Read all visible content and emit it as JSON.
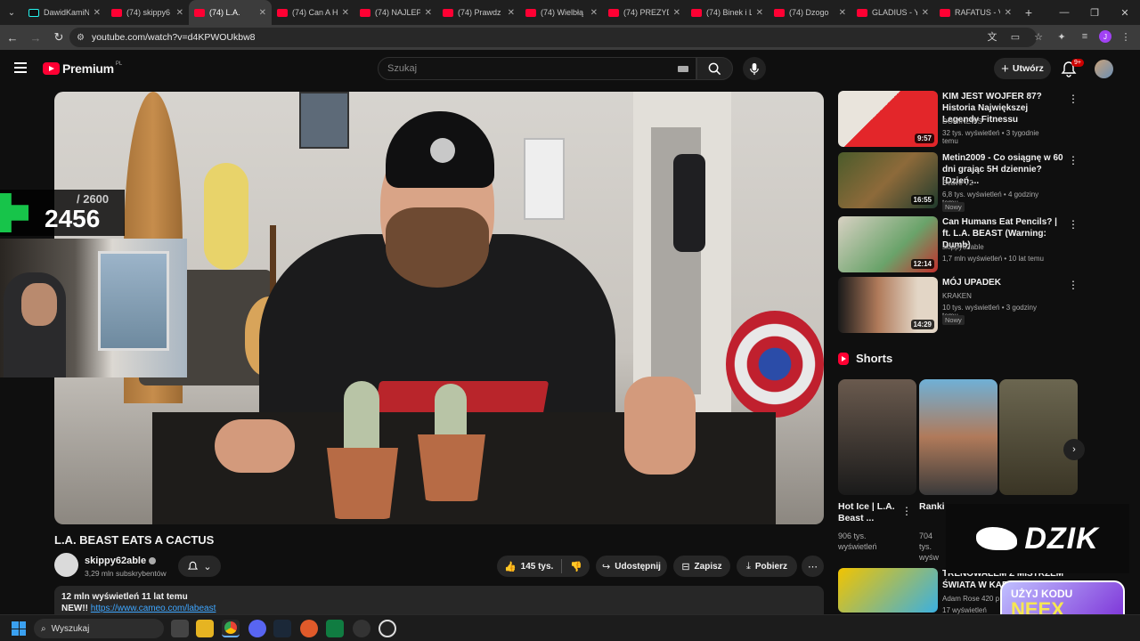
{
  "browser": {
    "tabs": [
      {
        "title": "DawidKamiN",
        "icon": "tiktok-icon",
        "active": false
      },
      {
        "title": "(74) skippy6",
        "icon": "youtube-icon",
        "active": false
      },
      {
        "title": "(74) L.A.",
        "icon": "youtube-icon",
        "active": true
      },
      {
        "title": "(74) Can A H",
        "icon": "youtube-icon",
        "active": false
      },
      {
        "title": "(74) NAJLEP",
        "icon": "youtube-icon",
        "active": false
      },
      {
        "title": "(74) Prawdz",
        "icon": "youtube-icon",
        "active": false
      },
      {
        "title": "(74) Wielbłą",
        "icon": "youtube-icon",
        "active": false
      },
      {
        "title": "(74) PREZYD",
        "icon": "youtube-icon",
        "active": false
      },
      {
        "title": "(74) Binek i L",
        "icon": "youtube-icon",
        "active": false
      },
      {
        "title": "(74) Dzogo",
        "icon": "youtube-icon",
        "active": false
      },
      {
        "title": "GLADIUS - Y",
        "icon": "youtube-icon",
        "active": false
      },
      {
        "title": "RAFATUS - V",
        "icon": "youtube-icon",
        "active": false
      }
    ],
    "url": "youtube.com/watch?v=d4KPWOUkbw8",
    "profile_initial": "J"
  },
  "youtube": {
    "brand": "Premium",
    "country_code": "PL",
    "search_placeholder": "Szukaj",
    "create_label": "Utwórz",
    "notification_badge": "9+"
  },
  "overlay": {
    "counter_max": "/ 2600",
    "counter_current": "2456"
  },
  "video": {
    "title": "L.A. BEAST EATS A CACTUS",
    "channel": "skippy62able",
    "subscribers": "3,29 mln subskrybentów",
    "likes": "145 tys.",
    "share_label": "Udostępnij",
    "save_label": "Zapisz",
    "download_label": "Pobierz",
    "description_meta": "12 mln wyświetleń  11 lat temu",
    "description_prefix": "NEW!! ",
    "description_link": "https://www.cameo.com/labeast"
  },
  "recommendations": [
    {
      "title": "KIM JEST WOJFER 87? Historia Największej Legendy Fitnessu",
      "channel": "DOMINEWS",
      "meta": "32 tys. wyświetleń • 3 tygodnie temu",
      "duration": "9:57",
      "new": ""
    },
    {
      "title": "Metin2009 - Co osiągnę w 60 dni grając 5H dziennie? [Dzień ...",
      "channel": "Beave V2",
      "meta": "6,8 tys. wyświetleń • 4 godziny temu",
      "duration": "16:55",
      "new": "Nowy"
    },
    {
      "title": "Can Humans Eat Pencils? | ft. L.A. BEAST (Warning: Dumb)",
      "channel": "skippy62able",
      "meta": "1,7 mln wyświetleń • 10 lat temu",
      "duration": "12:14",
      "new": ""
    },
    {
      "title": "MÓJ UPADEK",
      "channel": "KRAKEN",
      "meta": "10 tys. wyświetleń • 3 godziny temu",
      "duration": "14:29",
      "new": "Nowy"
    }
  ],
  "shorts": {
    "heading": "Shorts",
    "items": [
      {
        "title": "Hot Ice | L.A. Beast ...",
        "views": "906 tys. wyświetleń"
      },
      {
        "title": "Ranki",
        "views": "704 tys. wyśw"
      },
      {
        "title": "",
        "views": ""
      }
    ]
  },
  "rec5": {
    "title": "TRENOWAŁEM Z MISTRZEM ŚWIATA W KAR...",
    "channel": "Adam Rose 420 p",
    "meta": "17 wyświetleń"
  },
  "ads": {
    "dzik_word": "DZIK",
    "neex_line1": "UŻYJ KODU",
    "neex_line2": "NEEX"
  },
  "taskbar": {
    "search_label": "Wyszukaj"
  }
}
